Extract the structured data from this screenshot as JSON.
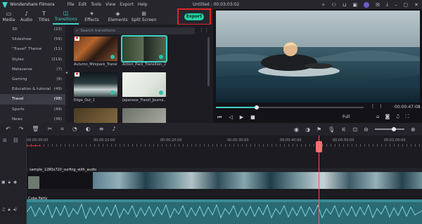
{
  "titlebar": {
    "app_name": "Wondershare Filmora",
    "menu": [
      "File",
      "Edit",
      "Tools",
      "View",
      "Export",
      "Help"
    ],
    "doc_title": "Untitled : 00:03:03:02"
  },
  "toolbar": {
    "tabs": [
      {
        "label": "Media",
        "icon": "folder-icon"
      },
      {
        "label": "Audio",
        "icon": "music-note-icon"
      },
      {
        "label": "Titles",
        "icon": "text-icon"
      },
      {
        "label": "Transitions",
        "icon": "transitions-icon",
        "active": true
      },
      {
        "label": "Effects",
        "icon": "effects-icon"
      },
      {
        "label": "Elements",
        "icon": "elements-icon"
      },
      {
        "label": "Split Screen",
        "icon": "split-screen-icon"
      }
    ],
    "export_label": "Export"
  },
  "categories": [
    {
      "name": "3D",
      "count": "(23)"
    },
    {
      "name": "Slideshow",
      "count": "(59)"
    },
    {
      "name": "\"Travel\" Theme",
      "count": "(11)"
    },
    {
      "name": "Styles",
      "count": "(219)"
    },
    {
      "name": "Metaverse",
      "count": "(7)"
    },
    {
      "name": "Gaming",
      "count": "(9)"
    },
    {
      "name": "Education & tutorial",
      "count": "(49)"
    },
    {
      "name": "Travel",
      "count": "(98)",
      "active": true
    },
    {
      "name": "Sports",
      "count": "(49)"
    },
    {
      "name": "News",
      "count": "(36)"
    }
  ],
  "search": {
    "placeholder": "Search transitions"
  },
  "transitions": [
    {
      "label": "Autumn_Minipack_Transiti..."
    },
    {
      "label": "Action_Pack_Transition_2",
      "selected": true
    },
    {
      "label": "Edge_Out_1"
    },
    {
      "label": "Japanese_Travel_Journa..."
    },
    {
      "label": ""
    },
    {
      "label": ""
    }
  ],
  "preview": {
    "timecode": "00:00:47:08",
    "quality": "Full",
    "progress": 0.27
  },
  "timeline": {
    "ruler_times": [
      "00:00:00:00",
      "00:00:10:00",
      "00:00:20:00",
      "00:00:30:00",
      "00:00:40:00",
      "00:00:50:00",
      "00:01:00:00"
    ],
    "video_clip_label": "sample_1280x720_surfing_with_audio",
    "audio_clip_label": "Cuba Party"
  },
  "colors": {
    "accent": "#3fd3c8",
    "export": "#22d3a3",
    "highlight_box": "#e0252b",
    "playhead": "#f05a5a"
  }
}
